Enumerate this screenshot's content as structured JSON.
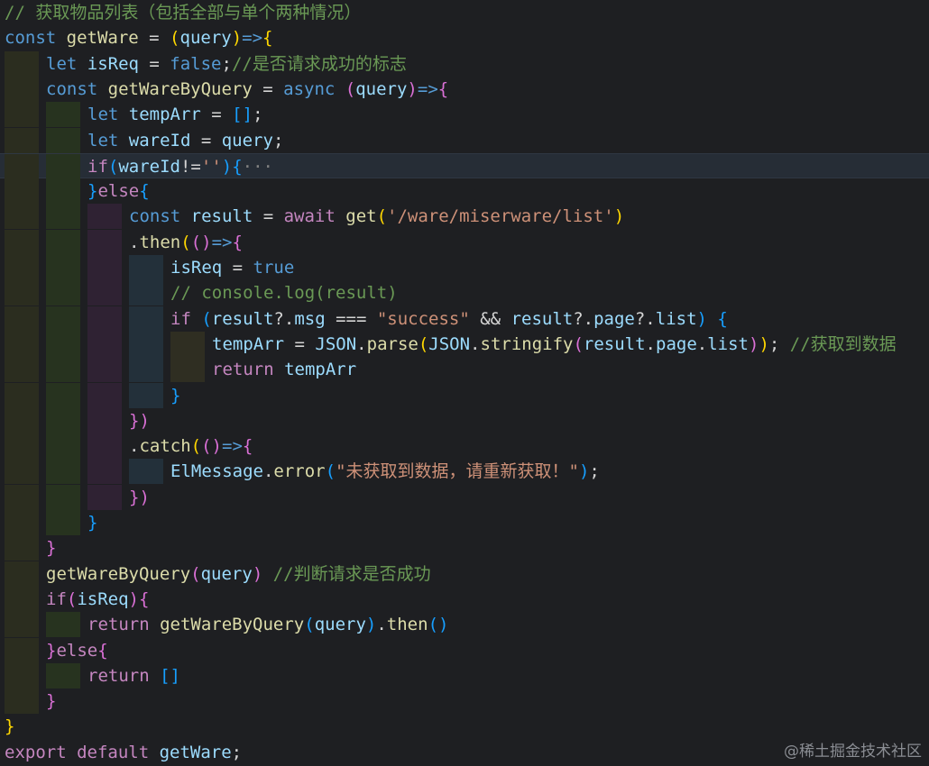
{
  "editor": {
    "lines": [
      [
        {
          "t": "// 获取物品列表（包括全部与单个两种情况）",
          "c": "comment"
        }
      ],
      [
        {
          "t": "const ",
          "c": "kw"
        },
        {
          "t": "getWare",
          "c": "fn"
        },
        {
          "t": " = ",
          "c": "punc"
        },
        {
          "t": "(",
          "c": "paren1"
        },
        {
          "t": "query",
          "c": "var"
        },
        {
          "t": ")",
          "c": "paren1"
        },
        {
          "t": "=>",
          "c": "kw"
        },
        {
          "t": "{",
          "c": "paren1"
        }
      ],
      [
        {
          "t": "let ",
          "c": "kw"
        },
        {
          "t": "isReq",
          "c": "var"
        },
        {
          "t": " = ",
          "c": "punc"
        },
        {
          "t": "false",
          "c": "kw"
        },
        {
          "t": ";",
          "c": "punc"
        },
        {
          "t": "//是否请求成功的标志",
          "c": "comment"
        }
      ],
      [
        {
          "t": "const ",
          "c": "kw"
        },
        {
          "t": "getWareByQuery",
          "c": "fn"
        },
        {
          "t": " = ",
          "c": "punc"
        },
        {
          "t": "async ",
          "c": "kw"
        },
        {
          "t": "(",
          "c": "paren2"
        },
        {
          "t": "query",
          "c": "var"
        },
        {
          "t": ")",
          "c": "paren2"
        },
        {
          "t": "=>",
          "c": "kw"
        },
        {
          "t": "{",
          "c": "paren2"
        }
      ],
      [
        {
          "t": "let ",
          "c": "kw"
        },
        {
          "t": "tempArr",
          "c": "var"
        },
        {
          "t": " = ",
          "c": "punc"
        },
        {
          "t": "[]",
          "c": "paren3"
        },
        {
          "t": ";",
          "c": "punc"
        }
      ],
      [
        {
          "t": "let ",
          "c": "kw"
        },
        {
          "t": "wareId",
          "c": "var"
        },
        {
          "t": " = ",
          "c": "punc"
        },
        {
          "t": "query",
          "c": "var"
        },
        {
          "t": ";",
          "c": "punc"
        }
      ],
      [
        {
          "t": "if",
          "c": "kw2"
        },
        {
          "t": "(",
          "c": "paren3"
        },
        {
          "t": "wareId",
          "c": "var"
        },
        {
          "t": "!=",
          "c": "punc"
        },
        {
          "t": "''",
          "c": "str"
        },
        {
          "t": ")",
          "c": "paren3"
        },
        {
          "t": "{",
          "c": "paren3"
        },
        {
          "t": "···",
          "c": "fold"
        }
      ],
      [
        {
          "t": "}",
          "c": "paren3"
        },
        {
          "t": "else",
          "c": "kw2"
        },
        {
          "t": "{",
          "c": "paren3"
        }
      ],
      [
        {
          "t": "const ",
          "c": "kw"
        },
        {
          "t": "result",
          "c": "var"
        },
        {
          "t": " = ",
          "c": "punc"
        },
        {
          "t": "await ",
          "c": "kw2"
        },
        {
          "t": "get",
          "c": "fn"
        },
        {
          "t": "(",
          "c": "paren1"
        },
        {
          "t": "'/ware/miserware/list'",
          "c": "str"
        },
        {
          "t": ")",
          "c": "paren1"
        }
      ],
      [
        {
          "t": ".",
          "c": "punc"
        },
        {
          "t": "then",
          "c": "fn"
        },
        {
          "t": "(",
          "c": "paren1"
        },
        {
          "t": "()",
          "c": "paren2"
        },
        {
          "t": "=>",
          "c": "kw"
        },
        {
          "t": "{",
          "c": "paren2"
        }
      ],
      [
        {
          "t": "isReq",
          "c": "var"
        },
        {
          "t": " = ",
          "c": "punc"
        },
        {
          "t": "true",
          "c": "kw"
        }
      ],
      [
        {
          "t": "// console.log(result)",
          "c": "comment"
        }
      ],
      [
        {
          "t": "if ",
          "c": "kw2"
        },
        {
          "t": "(",
          "c": "paren3"
        },
        {
          "t": "result",
          "c": "var"
        },
        {
          "t": "?.",
          "c": "punc"
        },
        {
          "t": "msg",
          "c": "var"
        },
        {
          "t": " === ",
          "c": "punc"
        },
        {
          "t": "\"success\"",
          "c": "str"
        },
        {
          "t": " && ",
          "c": "punc"
        },
        {
          "t": "result",
          "c": "var"
        },
        {
          "t": "?.",
          "c": "punc"
        },
        {
          "t": "page",
          "c": "var"
        },
        {
          "t": "?.",
          "c": "punc"
        },
        {
          "t": "list",
          "c": "var"
        },
        {
          "t": ")",
          "c": "paren3"
        },
        {
          "t": " {",
          "c": "paren3"
        }
      ],
      [
        {
          "t": "tempArr",
          "c": "var"
        },
        {
          "t": " = ",
          "c": "punc"
        },
        {
          "t": "JSON",
          "c": "var"
        },
        {
          "t": ".",
          "c": "punc"
        },
        {
          "t": "parse",
          "c": "fn"
        },
        {
          "t": "(",
          "c": "paren1"
        },
        {
          "t": "JSON",
          "c": "var"
        },
        {
          "t": ".",
          "c": "punc"
        },
        {
          "t": "stringify",
          "c": "fn"
        },
        {
          "t": "(",
          "c": "paren2"
        },
        {
          "t": "result",
          "c": "var"
        },
        {
          "t": ".",
          "c": "punc"
        },
        {
          "t": "page",
          "c": "var"
        },
        {
          "t": ".",
          "c": "punc"
        },
        {
          "t": "list",
          "c": "var"
        },
        {
          "t": ")",
          "c": "paren2"
        },
        {
          "t": ")",
          "c": "paren1"
        },
        {
          "t": "; ",
          "c": "punc"
        },
        {
          "t": "//获取到数据",
          "c": "comment"
        }
      ],
      [
        {
          "t": "return ",
          "c": "kw2"
        },
        {
          "t": "tempArr",
          "c": "var"
        }
      ],
      [
        {
          "t": "}",
          "c": "paren3"
        }
      ],
      [
        {
          "t": "})",
          "c": "paren2"
        }
      ],
      [
        {
          "t": ".",
          "c": "punc"
        },
        {
          "t": "catch",
          "c": "fn"
        },
        {
          "t": "(",
          "c": "paren1"
        },
        {
          "t": "()",
          "c": "paren2"
        },
        {
          "t": "=>",
          "c": "kw"
        },
        {
          "t": "{",
          "c": "paren2"
        }
      ],
      [
        {
          "t": "ElMessage",
          "c": "var"
        },
        {
          "t": ".",
          "c": "punc"
        },
        {
          "t": "error",
          "c": "fn"
        },
        {
          "t": "(",
          "c": "paren3"
        },
        {
          "t": "\"未获取到数据，请重新获取！\"",
          "c": "str"
        },
        {
          "t": ")",
          "c": "paren3"
        },
        {
          "t": ";",
          "c": "punc"
        }
      ],
      [
        {
          "t": "})",
          "c": "paren2"
        }
      ],
      [
        {
          "t": "}",
          "c": "paren3"
        }
      ],
      [
        {
          "t": "}",
          "c": "paren2"
        }
      ],
      [
        {
          "t": "getWareByQuery",
          "c": "fn"
        },
        {
          "t": "(",
          "c": "paren2"
        },
        {
          "t": "query",
          "c": "var"
        },
        {
          "t": ")",
          "c": "paren2"
        },
        {
          "t": " ",
          "c": "punc"
        },
        {
          "t": "//判断请求是否成功",
          "c": "comment"
        }
      ],
      [
        {
          "t": "if",
          "c": "kw2"
        },
        {
          "t": "(",
          "c": "paren2"
        },
        {
          "t": "isReq",
          "c": "var"
        },
        {
          "t": ")",
          "c": "paren2"
        },
        {
          "t": "{",
          "c": "paren2"
        }
      ],
      [
        {
          "t": "return ",
          "c": "kw2"
        },
        {
          "t": "getWareByQuery",
          "c": "fn"
        },
        {
          "t": "(",
          "c": "paren3"
        },
        {
          "t": "query",
          "c": "var"
        },
        {
          "t": ")",
          "c": "paren3"
        },
        {
          "t": ".",
          "c": "punc"
        },
        {
          "t": "then",
          "c": "fn"
        },
        {
          "t": "()",
          "c": "paren3"
        }
      ],
      [
        {
          "t": "}",
          "c": "paren2"
        },
        {
          "t": "else",
          "c": "kw2"
        },
        {
          "t": "{",
          "c": "paren2"
        }
      ],
      [
        {
          "t": "return ",
          "c": "kw2"
        },
        {
          "t": "[]",
          "c": "paren3"
        }
      ],
      [
        {
          "t": "}",
          "c": "paren2"
        }
      ],
      [
        {
          "t": "}",
          "c": "paren1"
        }
      ],
      [
        {
          "t": "export ",
          "c": "kw2"
        },
        {
          "t": "default ",
          "c": "kw2"
        },
        {
          "t": "getWare",
          "c": "var"
        },
        {
          "t": ";",
          "c": "punc"
        }
      ]
    ],
    "watermark": "@稀土掘金技术社区"
  }
}
